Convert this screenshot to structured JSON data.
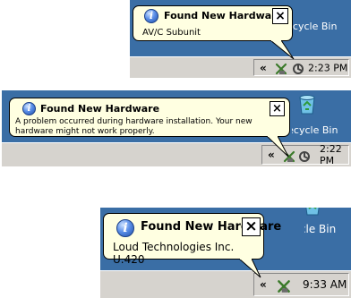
{
  "notifications": [
    {
      "title": "Found New Hardware",
      "message": "AV/C Subunit",
      "close_glyph": "×",
      "tray_expand": "«",
      "clock": "2:23 PM",
      "desktop_label": "Recycle Bin"
    },
    {
      "title": "Found New Hardware",
      "message": "A problem occurred during hardware installation. Your new hardware might not work properly.",
      "close_glyph": "×",
      "tray_expand": "«",
      "clock": "2:22 PM",
      "desktop_label": "Recycle Bin"
    },
    {
      "title": "Found New Hardware",
      "message": "Loud Technologies Inc. U.420",
      "close_glyph": "×",
      "tray_expand": "«",
      "clock": "9:33 AM",
      "desktop_label": "Recycle Bin"
    }
  ],
  "colors": {
    "desktop": "#3a6ea5",
    "balloon": "#ffffe1",
    "taskbar": "#d6d3ce"
  },
  "icons": [
    "info-icon",
    "close-icon",
    "recycle-bin-icon",
    "hardware-icon",
    "volume-icon"
  ]
}
